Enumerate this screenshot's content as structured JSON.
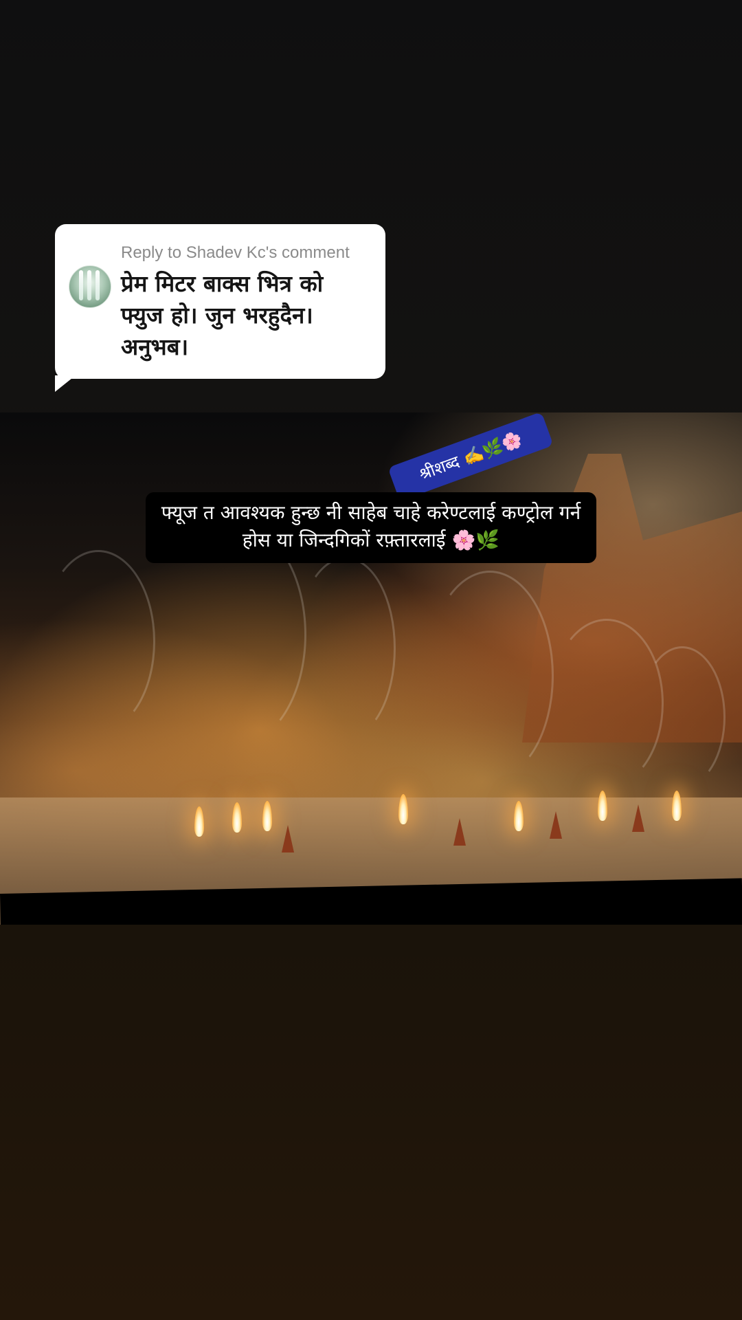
{
  "reply": {
    "header": "Reply to Shadev Kc's comment",
    "comment": "प्रेम मिटर बाक्स भित्र को फ्युज हो। जुन भरहुदैन। अनुभब।",
    "avatar_icon": "waterfall-avatar"
  },
  "video": {
    "signature": "श्रीशब्द ✍️🌿🌸",
    "caption": "फ्यूज त आवश्यक हुन्छ नी साहेब चाहे करेण्टलाई कण्ट्रोल गर्न होस या जिन्दगिकों रफ़्तारलाई 🌸🌿"
  },
  "colors": {
    "reply_bg": "#ffffff",
    "signature_bg": "#2533a6",
    "caption_bg": "#000000"
  }
}
